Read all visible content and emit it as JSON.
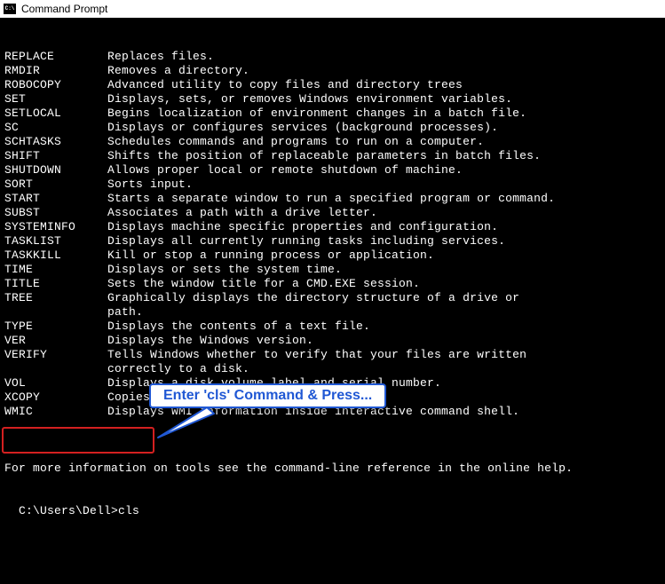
{
  "window": {
    "title": "Command Prompt"
  },
  "commands": [
    {
      "name": "REPLACE",
      "desc": "Replaces files."
    },
    {
      "name": "RMDIR",
      "desc": "Removes a directory."
    },
    {
      "name": "ROBOCOPY",
      "desc": "Advanced utility to copy files and directory trees"
    },
    {
      "name": "SET",
      "desc": "Displays, sets, or removes Windows environment variables."
    },
    {
      "name": "SETLOCAL",
      "desc": "Begins localization of environment changes in a batch file."
    },
    {
      "name": "SC",
      "desc": "Displays or configures services (background processes)."
    },
    {
      "name": "SCHTASKS",
      "desc": "Schedules commands and programs to run on a computer."
    },
    {
      "name": "SHIFT",
      "desc": "Shifts the position of replaceable parameters in batch files."
    },
    {
      "name": "SHUTDOWN",
      "desc": "Allows proper local or remote shutdown of machine."
    },
    {
      "name": "SORT",
      "desc": "Sorts input."
    },
    {
      "name": "START",
      "desc": "Starts a separate window to run a specified program or command."
    },
    {
      "name": "SUBST",
      "desc": "Associates a path with a drive letter."
    },
    {
      "name": "SYSTEMINFO",
      "desc": "Displays machine specific properties and configuration."
    },
    {
      "name": "TASKLIST",
      "desc": "Displays all currently running tasks including services."
    },
    {
      "name": "TASKKILL",
      "desc": "Kill or stop a running process or application."
    },
    {
      "name": "TIME",
      "desc": "Displays or sets the system time."
    },
    {
      "name": "TITLE",
      "desc": "Sets the window title for a CMD.EXE session."
    },
    {
      "name": "TREE",
      "desc": "Graphically displays the directory structure of a drive or",
      "cont": "path."
    },
    {
      "name": "TYPE",
      "desc": "Displays the contents of a text file."
    },
    {
      "name": "VER",
      "desc": "Displays the Windows version."
    },
    {
      "name": "VERIFY",
      "desc": "Tells Windows whether to verify that your files are written",
      "cont": "correctly to a disk."
    },
    {
      "name": "VOL",
      "desc": "Displays a disk volume label and serial number."
    },
    {
      "name": "XCOPY",
      "desc": "Copies files and directory trees."
    },
    {
      "name": "WMIC",
      "desc": "Displays WMI information inside interactive command shell."
    }
  ],
  "more_info": "For more information on tools see the command-line reference in the online help.",
  "prompt": {
    "path": "C:\\Users\\Dell>",
    "input": "cls"
  },
  "annotation": {
    "label": "Enter 'cls' Command & Press..."
  }
}
